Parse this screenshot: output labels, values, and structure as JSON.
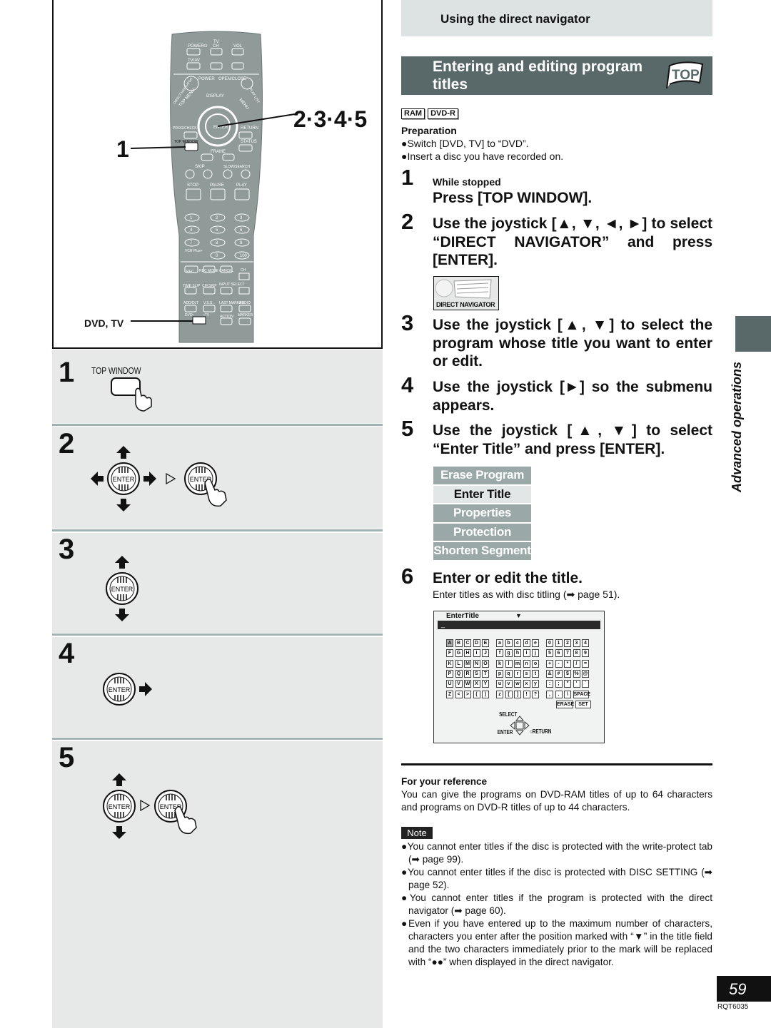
{
  "header": {
    "section": "Using the direct navigator",
    "title": "Entering and editing program titles",
    "top_badge": "TOP"
  },
  "tags": [
    "RAM",
    "DVD-R"
  ],
  "preparation": {
    "heading": "Preparation",
    "items": [
      "●Switch [DVD, TV] to “DVD”.",
      "●Insert a disc you have recorded on."
    ]
  },
  "steps": [
    {
      "num": "1",
      "sub": "While stopped",
      "text": "Press [TOP WINDOW]."
    },
    {
      "num": "2",
      "text": "Use the joystick [▲, ▼, ◄, ►] to select “DIRECT NAVIGATOR” and press [ENTER]."
    },
    {
      "num": "3",
      "text": "Use the joystick [▲, ▼] to select the program whose title you want to enter or edit."
    },
    {
      "num": "4",
      "text": "Use the joystick [►] so the submenu appears."
    },
    {
      "num": "5",
      "text": "Use the joystick [▲, ▼] to select “Enter Title” and press [ENTER]."
    },
    {
      "num": "6",
      "text": "Enter or edit the title.",
      "sub": "Enter titles as with disc titling (➡ page 51)."
    }
  ],
  "direct_navigator_icon": "DIRECT NAVIGATOR",
  "submenu": {
    "items": [
      "Erase Program",
      "Enter Title",
      "Properties",
      "Protection",
      "Shorten Segment"
    ],
    "selected": "Enter Title"
  },
  "enter_title_screen": {
    "title": "EnterTitle",
    "cursor": "_",
    "upper": [
      [
        "A",
        "B",
        "C",
        "D",
        "E"
      ],
      [
        "F",
        "G",
        "H",
        "I",
        "J"
      ],
      [
        "K",
        "L",
        "M",
        "N",
        "O"
      ],
      [
        "P",
        "Q",
        "R",
        "S",
        "T"
      ],
      [
        "U",
        "V",
        "W",
        "X",
        "Y"
      ],
      [
        "Z",
        "<",
        ">",
        "(",
        ")"
      ]
    ],
    "lower": [
      [
        "a",
        "b",
        "c",
        "d",
        "e"
      ],
      [
        "f",
        "g",
        "h",
        "i",
        "j"
      ],
      [
        "k",
        "l",
        "m",
        "n",
        "o"
      ],
      [
        "p",
        "q",
        "r",
        "s",
        "t"
      ],
      [
        "u",
        "v",
        "w",
        "x",
        "y"
      ],
      [
        "z",
        "[",
        "]",
        "!",
        "?"
      ]
    ],
    "symbols": [
      [
        "0",
        "1",
        "2",
        "3",
        "4"
      ],
      [
        "5",
        "6",
        "7",
        "8",
        "9"
      ],
      [
        "+",
        "-",
        "*",
        "/",
        "="
      ],
      [
        "&",
        "#",
        "$",
        "%",
        "@"
      ],
      [
        ":",
        ";",
        "\"",
        "'",
        "`"
      ],
      [
        ",",
        ".",
        "\\",
        "SPACE"
      ]
    ],
    "erase": "ERASE",
    "set": "SET",
    "select": "SELECT",
    "enter": "ENTER",
    "return": "RETURN"
  },
  "reference": {
    "heading": "For your reference",
    "text": "You can give the programs on DVD-RAM titles of up to 64 characters and programs on DVD-R titles of up to 44 characters."
  },
  "note": {
    "label": "Note",
    "items": [
      "●You cannot enter titles if the disc is protected with the write-protect tab (➡ page 99).",
      "●You cannot enter titles if the disc is protected with DISC SETTING (➡ page 52).",
      "●You cannot enter titles if the program is protected with the direct navigator (➡ page 60).",
      "●Even if you have entered up to the maximum number of characters, characters you enter after the position marked with “▼” in the title field and the two characters immediately prior to the mark will be replaced with “●●” when displayed in the direct navigator."
    ]
  },
  "side_tab": "Advanced operations",
  "page_number": "59",
  "doc_code": "RQT6035",
  "remote": {
    "callout_steps": "2·3·4·5",
    "callout_1": "1",
    "callout_dvdtv": "DVD, TV",
    "labels": {
      "tv": "TV",
      "power_tv": "POWER⏻",
      "ch": "CH",
      "vol": "VOL",
      "tvav": "TV/AV",
      "power": "POWER",
      "openclose": "OPEN/CLOSE",
      "display": "DISPLAY",
      "topmenu": "TOP MENU",
      "menu": "MENU",
      "direct": "DIRECT NAVIGATOR",
      "playlist": "PLAY LIST",
      "progcheck": "PROG/CHECK",
      "return": "RETURN",
      "enter": "ENTER",
      "topwindow": "TOP WINDOW",
      "status": "STATUS",
      "frame": "FRAME",
      "skip": "SKIP",
      "slow": "SLOW/SEARCH",
      "stop": "STOP",
      "pause": "PAUSE",
      "play": "PLAY",
      "vcrplus": "VCR Plus+",
      "rec": "REC",
      "recmode": "REC MODE",
      "cancel": "CANCEL",
      "dvdch": "CH",
      "timeslip": "TIME SLIP",
      "cmskip": "CM SKIP",
      "input": "INPUT SELECT",
      "adddlt": "ADD/DLT",
      "vss": "V.S.S.",
      "lastmarker": "LAST MARKER",
      "audio": "AUDIO",
      "dvd": "DVD•",
      "tvsw": "•TV",
      "action": "ACTION",
      "marker": "MARKER WRITE"
    },
    "numbers": [
      "1",
      "2",
      "3",
      "4",
      "5",
      "6",
      "7",
      "8",
      "9",
      "0",
      "100"
    ]
  },
  "panels": [
    {
      "num": "1",
      "label": "TOP WINDOW"
    },
    {
      "num": "2"
    },
    {
      "num": "3"
    },
    {
      "num": "4"
    },
    {
      "num": "5"
    }
  ],
  "icons": {
    "enter_label": "ENTER"
  },
  "colors": {
    "header_dark": "#596869",
    "header_light": "#dde2e2",
    "menu_item": "#9aa8a7",
    "panel": "#e7e9e9"
  }
}
